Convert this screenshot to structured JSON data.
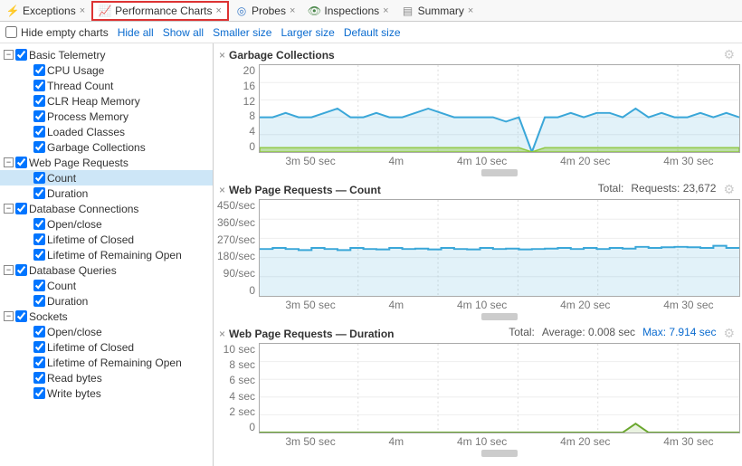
{
  "tabs": [
    {
      "label": "Exceptions",
      "icon": "⚡",
      "color": "#e08a00"
    },
    {
      "label": "Performance Charts",
      "icon": "📈",
      "color": "#3a7ac8",
      "active": true
    },
    {
      "label": "Probes",
      "icon": "◎",
      "color": "#3a7ac8"
    },
    {
      "label": "Inspections",
      "icon": "👁",
      "color": "#4a874a"
    },
    {
      "label": "Summary",
      "icon": "▤",
      "color": "#888"
    }
  ],
  "toolbar": {
    "hide_empty": "Hide empty charts",
    "hide_all": "Hide all",
    "show_all": "Show all",
    "smaller": "Smaller size",
    "larger": "Larger size",
    "default": "Default size"
  },
  "tree": [
    {
      "label": "Basic Telemetry",
      "type": "group",
      "children": [
        "CPU Usage",
        "Thread Count",
        "CLR Heap Memory",
        "Process Memory",
        "Loaded Classes",
        "Garbage Collections"
      ]
    },
    {
      "label": "Web Page Requests",
      "type": "group",
      "children": [
        "Count",
        "Duration"
      ],
      "selected_child": 0
    },
    {
      "label": "Database Connections",
      "type": "group",
      "children": [
        "Open/close",
        "Lifetime of Closed",
        "Lifetime of Remaining Open"
      ]
    },
    {
      "label": "Database Queries",
      "type": "group",
      "children": [
        "Count",
        "Duration"
      ]
    },
    {
      "label": "Sockets",
      "type": "group",
      "children": [
        "Open/close",
        "Lifetime of Closed",
        "Lifetime of Remaining Open",
        "Read bytes",
        "Write bytes"
      ]
    }
  ],
  "charts": [
    {
      "title": "Garbage Collections",
      "ylabels": [
        "20",
        "16",
        "12",
        "8",
        "4",
        "0"
      ],
      "xlabels": [
        "3m 50 sec",
        "4m",
        "4m 10 sec",
        "4m 20 sec",
        "4m 30 sec"
      ],
      "height": 98,
      "series": [
        {
          "name": "blue",
          "color": "#3aa7d9",
          "values": [
            8,
            8,
            9,
            8,
            8,
            9,
            10,
            8,
            8,
            9,
            8,
            8,
            9,
            10,
            9,
            8,
            8,
            8,
            8,
            7,
            8,
            0,
            8,
            8,
            9,
            8,
            9,
            9,
            8,
            10,
            8,
            9,
            8,
            8,
            9,
            8,
            9,
            8
          ]
        },
        {
          "name": "green",
          "color": "#8dc63f",
          "fill": true,
          "values": [
            1,
            1,
            1,
            1,
            1,
            1,
            1,
            1,
            1,
            1,
            1,
            1,
            1,
            1,
            1,
            1,
            1,
            1,
            1,
            1,
            1,
            0,
            1,
            1,
            1,
            1,
            1,
            1,
            1,
            1,
            1,
            1,
            1,
            1,
            1,
            1,
            1,
            1
          ]
        }
      ],
      "ymax": 20
    },
    {
      "title": "Web Page Requests — Count",
      "stats": {
        "total_label": "Total:",
        "requests_label": "Requests:",
        "requests_value": "23,672"
      },
      "ylabels": [
        "450/sec",
        "360/sec",
        "270/sec",
        "180/sec",
        "90/sec",
        "0"
      ],
      "xlabels": [
        "3m 50 sec",
        "4m",
        "4m 10 sec",
        "4m 20 sec",
        "4m 30 sec"
      ],
      "height": 108,
      "series": [
        {
          "name": "count",
          "color": "#3aa7d9",
          "step": true,
          "values": [
            220,
            225,
            220,
            215,
            225,
            220,
            215,
            225,
            220,
            218,
            225,
            220,
            222,
            218,
            225,
            220,
            218,
            225,
            220,
            222,
            218,
            220,
            222,
            225,
            220,
            225,
            220,
            225,
            222,
            230,
            225,
            228,
            230,
            228,
            225,
            235,
            225,
            230
          ]
        }
      ],
      "ymax": 450
    },
    {
      "title": "Web Page Requests — Duration",
      "stats": {
        "total_label": "Total:",
        "avg_label": "Average:",
        "avg_value": "0.008 sec",
        "max_label": "Max:",
        "max_value": "7.914 sec"
      },
      "ylabels": [
        "10 sec",
        "8 sec",
        "6 sec",
        "4 sec",
        "2 sec",
        "0"
      ],
      "xlabels": [
        "3m 50 sec",
        "4m",
        "4m 10 sec",
        "4m 20 sec",
        "4m 30 sec"
      ],
      "height": 100,
      "series": [
        {
          "name": "dur-green",
          "color": "#6aa72e",
          "values": [
            0,
            0,
            0,
            0,
            0,
            0,
            0,
            0,
            0,
            0,
            0,
            0,
            0,
            0,
            0,
            0,
            0,
            0,
            0,
            0,
            0,
            0,
            0,
            0,
            0,
            0,
            0,
            0,
            0,
            1,
            0,
            0,
            0,
            0,
            0,
            0,
            0,
            0
          ]
        }
      ],
      "ymax": 10
    }
  ],
  "chart_data": [
    {
      "type": "line",
      "title": "Garbage Collections",
      "ylabel": "",
      "series": [
        {
          "name": "series-1",
          "values": [
            8,
            8,
            9,
            8,
            8,
            9,
            10,
            8,
            8,
            9,
            8,
            8,
            9,
            10,
            9,
            8,
            8,
            8,
            8,
            7,
            8,
            0,
            8,
            8,
            9,
            9,
            8,
            10,
            8,
            9,
            8,
            9,
            8,
            9
          ]
        },
        {
          "name": "series-2",
          "values": [
            1,
            1,
            1,
            1,
            1,
            1,
            1,
            1,
            1,
            1,
            1,
            1,
            1,
            1,
            1,
            1,
            1,
            1,
            1,
            1,
            1,
            0,
            1,
            1,
            1,
            1,
            1,
            1,
            1,
            1,
            1,
            1,
            1,
            1
          ]
        }
      ],
      "x_ticks": [
        "3m 50 sec",
        "4m",
        "4m 10 sec",
        "4m 20 sec",
        "4m 30 sec"
      ],
      "ylim": [
        0,
        20
      ]
    },
    {
      "type": "line",
      "title": "Web Page Requests — Count",
      "ylabel": "/sec",
      "series": [
        {
          "name": "count",
          "values": [
            220,
            225,
            220,
            215,
            225,
            220,
            215,
            225,
            220,
            218,
            225,
            220,
            222,
            218,
            225,
            220,
            218,
            225,
            220,
            222,
            218,
            220,
            222,
            225,
            220,
            225,
            222,
            230,
            225,
            228,
            230,
            228,
            235,
            230
          ]
        }
      ],
      "x_ticks": [
        "3m 50 sec",
        "4m",
        "4m 10 sec",
        "4m 20 sec",
        "4m 30 sec"
      ],
      "ylim": [
        0,
        450
      ],
      "total_requests": 23672
    },
    {
      "type": "line",
      "title": "Web Page Requests — Duration",
      "ylabel": "sec",
      "series": [
        {
          "name": "duration",
          "values": [
            0,
            0,
            0,
            0,
            0,
            0,
            0,
            0,
            0,
            0,
            0,
            0,
            0,
            0,
            0,
            0,
            0,
            0,
            0,
            0,
            0,
            0,
            0,
            0,
            0,
            0,
            0,
            0,
            0,
            1,
            0,
            0,
            0,
            0
          ]
        }
      ],
      "x_ticks": [
        "3m 50 sec",
        "4m",
        "4m 10 sec",
        "4m 20 sec",
        "4m 30 sec"
      ],
      "ylim": [
        0,
        10
      ],
      "average": 0.008,
      "max": 7.914
    }
  ]
}
